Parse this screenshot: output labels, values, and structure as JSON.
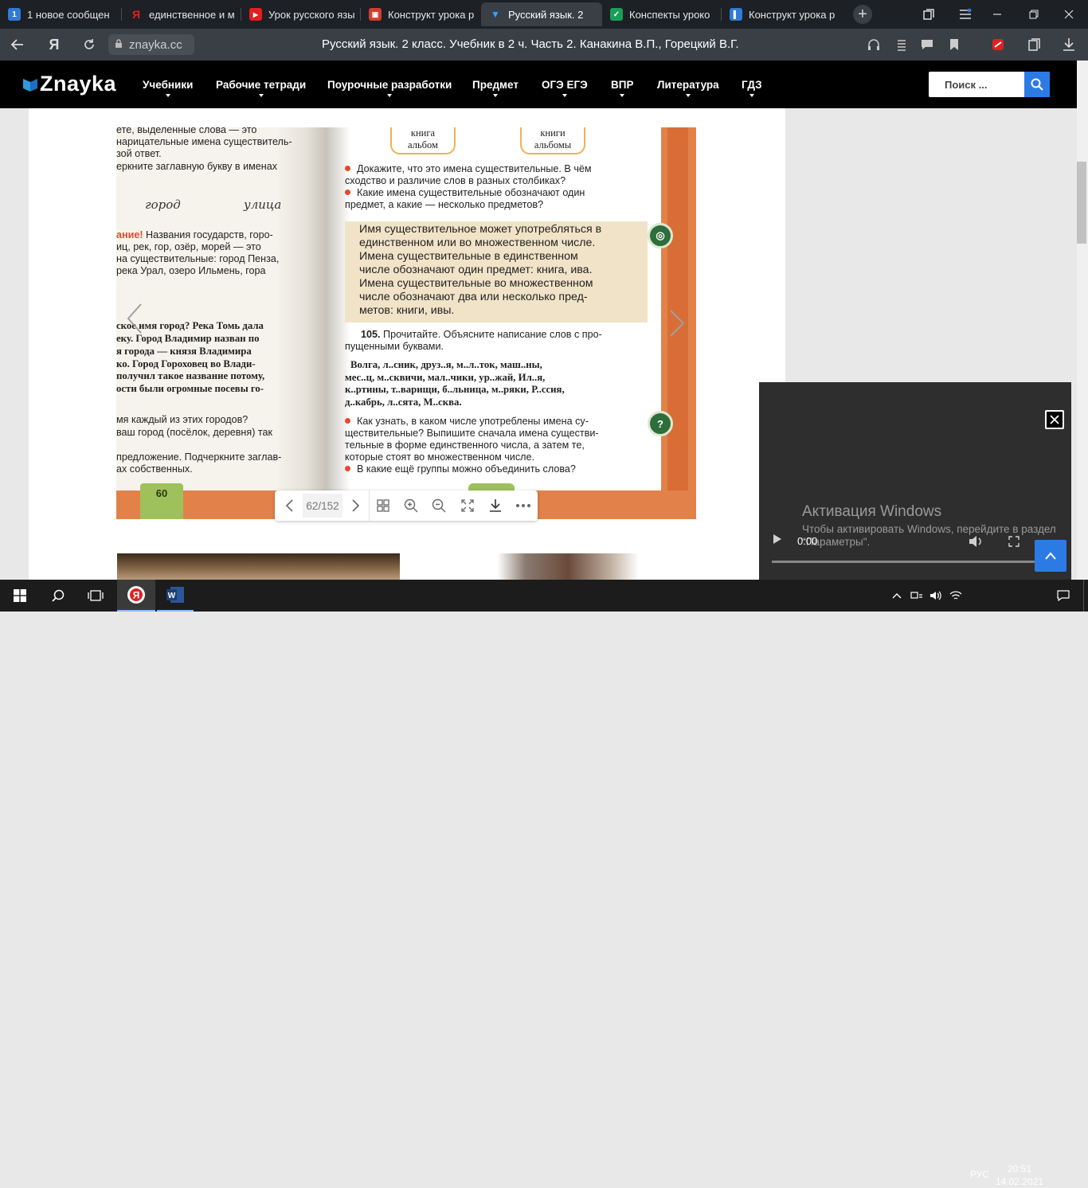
{
  "browser": {
    "tabs": [
      {
        "label": "1 новое сообщен",
        "fav_color": "#2f7bd6",
        "fav_text": "1"
      },
      {
        "label": "единственное и м",
        "fav_color": "#1d2025",
        "fav_text": "Я"
      },
      {
        "label": "Урок русского язы",
        "fav_color": "#e0201f",
        "fav_text": "▶"
      },
      {
        "label": "Конструкт урока р",
        "fav_color": "#d23c2e",
        "fav_text": "▣"
      },
      {
        "label": "Русский язык. 2",
        "fav_color": "#1d2025",
        "fav_text": "▼"
      },
      {
        "label": "Конспекты уроко",
        "fav_color": "#1a9e5a",
        "fav_text": "✓"
      },
      {
        "label": "Конструкт урока р",
        "fav_color": "#2f7bd6",
        "fav_text": "▌"
      }
    ],
    "new_tab": "+",
    "url": "znayka.cc",
    "page_title": "Русский язык. 2 класс. Учебник в 2 ч. Часть 2. Канакина В.П., Горецкий В.Г."
  },
  "site": {
    "logo": "Znayka",
    "menu": [
      {
        "label": "Учебники"
      },
      {
        "label": "Рабочие тетради"
      },
      {
        "label": "Поурочные разработки"
      },
      {
        "label": "Предмет"
      },
      {
        "label": "ОГЭ ЕГЭ"
      },
      {
        "label": "ВПР"
      },
      {
        "label": "Литература"
      },
      {
        "label": "ГДЗ"
      }
    ],
    "search_placeholder": "Поиск ..."
  },
  "book": {
    "left_page": {
      "lines": [
        "ете,  выделенные  слова  —  это",
        "нарицательные имена существитель-",
        "зой ответ.",
        "еркните заглавную букву в именах"
      ],
      "cursive_1": "город",
      "cursive_2": "улица",
      "attention_prefix": "ание!",
      "attention_lines": [
        " Названия государств, горо-",
        "иц, рек, гор, озёр, морей — это",
        "на существительные: город Пенза,",
        "река Урал, озеро Ильмень, гора"
      ],
      "serif_lines": [
        "ское имя город? Река Томь дала",
        "еку. Город Владимир назван по",
        "я города — князя Владимира",
        "ко. Город Гороховец во Влади-",
        " получил такое название потому,",
        "ости были огромные посевы го-"
      ],
      "lines_2": [
        "мя каждый из этих городов?",
        " ваш город (посёлок, деревня) так",
        "",
        " предложение. Подчеркните заглав-",
        "ах собственных."
      ],
      "page_number": "60"
    },
    "right_page": {
      "box1": [
        "книга",
        "альбом"
      ],
      "box2": [
        "книги",
        "альбомы"
      ],
      "q1": [
        "Докажите, что это имена существительные. В чём",
        "сходство и различие слов в разных столбиках?"
      ],
      "q2": [
        "Какие имена существительные обозначают один",
        "предмет, а какие — несколько предметов?"
      ],
      "rule_lines": [
        "Имя существительное может употребляться в",
        "единственном или во множественном числе.",
        "Имена существительные в единственном",
        "числе обозначают один предмет: книга, ива.",
        "Имена существительные во множественном",
        "числе обозначают два или несколько пред-",
        "метов: книги, ивы."
      ],
      "ex_number": "105.",
      "ex_lines": [
        " Прочитайте. Объясните написание слов с про-",
        "пущенными буквами."
      ],
      "words_lines": [
        "Волга, л..сник, друз..я, м..л..ток, маш..ны,",
        "мес..ц, м..сквичи, мал..чики, ур..жай, Ил..я,",
        "к..ртины, т..варищи, б..льница, м..ряки, Р..ссия,",
        "д..кабрь, л..сята, М..сква."
      ],
      "q3": [
        "Как узнать, в каком числе употреблены имена су-",
        "ществительные? Выпишите сначала имена существи-",
        "тельные в форме единственного числа, а затем те,",
        "которые стоят во множественном числе."
      ],
      "q4": [
        "В какие ещё группы можно объединить слова?"
      ]
    },
    "toolbar": {
      "page_counter": "62/152"
    }
  },
  "video": {
    "time": "0:00",
    "watermark_title": "Активация Windows",
    "watermark_text": "Чтобы активировать Windows, перейдите в раздел \"Параметры\"."
  },
  "taskbar": {
    "lang": "РУС",
    "time": "20:51",
    "date": "14.02.2021"
  },
  "colors": {
    "accent": "#2c7be5",
    "book_orange": "#e2824a",
    "rule_bg": "#f1e3c7"
  }
}
